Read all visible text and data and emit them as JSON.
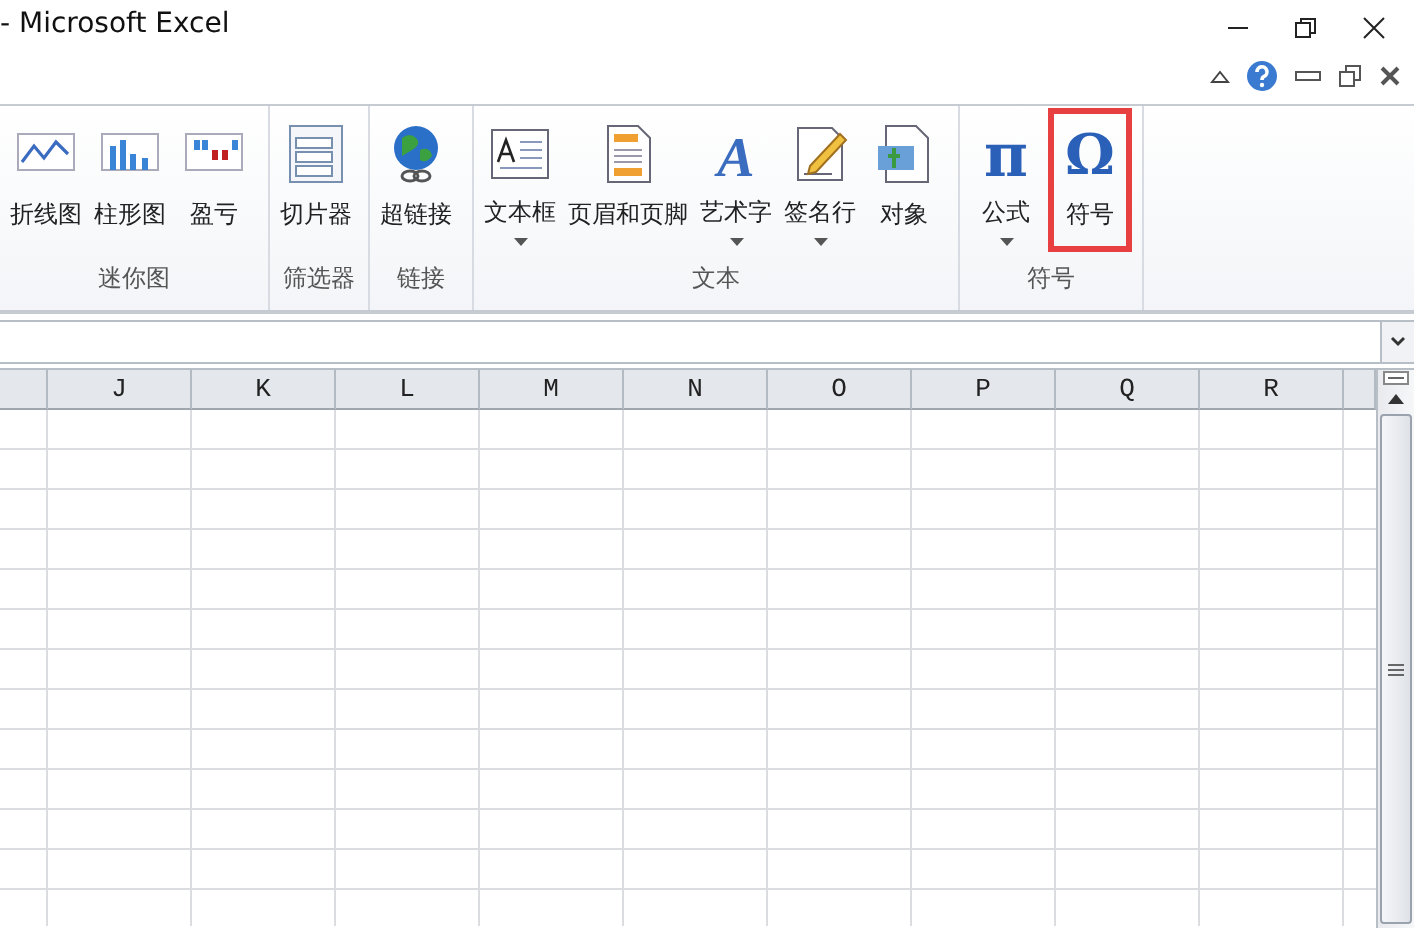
{
  "window": {
    "title": "- Microsoft Excel"
  },
  "ribbon": {
    "groups": [
      {
        "label": "迷你图",
        "buttons": [
          {
            "kind": "line",
            "label": "折线图",
            "dropdown": false,
            "highlighted": false
          },
          {
            "kind": "column",
            "label": "柱形图",
            "dropdown": false,
            "highlighted": false
          },
          {
            "kind": "winloss",
            "label": "盈亏",
            "dropdown": false,
            "highlighted": false
          }
        ]
      },
      {
        "label": "筛选器",
        "buttons": [
          {
            "kind": "slicer",
            "label": "切片器",
            "dropdown": false,
            "highlighted": false
          }
        ]
      },
      {
        "label": "链接",
        "buttons": [
          {
            "kind": "hyperlink",
            "label": "超链接",
            "dropdown": false,
            "highlighted": false
          }
        ]
      },
      {
        "label": "文本",
        "buttons": [
          {
            "kind": "textbox",
            "label": "文本框",
            "dropdown": true,
            "highlighted": false
          },
          {
            "kind": "header",
            "label": "页眉和页脚",
            "dropdown": false,
            "highlighted": false
          },
          {
            "kind": "wordart",
            "glyph": "A",
            "label": "艺术字",
            "dropdown": true,
            "highlighted": false
          },
          {
            "kind": "signature",
            "label": "签名行",
            "dropdown": true,
            "highlighted": false
          },
          {
            "kind": "object",
            "label": "对象",
            "dropdown": false,
            "highlighted": false
          }
        ]
      },
      {
        "label": "符号",
        "buttons": [
          {
            "kind": "equation",
            "glyph": "π",
            "label": "公式",
            "dropdown": true,
            "highlighted": false
          },
          {
            "kind": "symbol",
            "glyph": "Ω",
            "label": "符号",
            "dropdown": false,
            "highlighted": true
          }
        ]
      }
    ]
  },
  "sheet": {
    "columns": [
      "J",
      "K",
      "L",
      "M",
      "N",
      "O",
      "P",
      "Q",
      "R"
    ]
  }
}
